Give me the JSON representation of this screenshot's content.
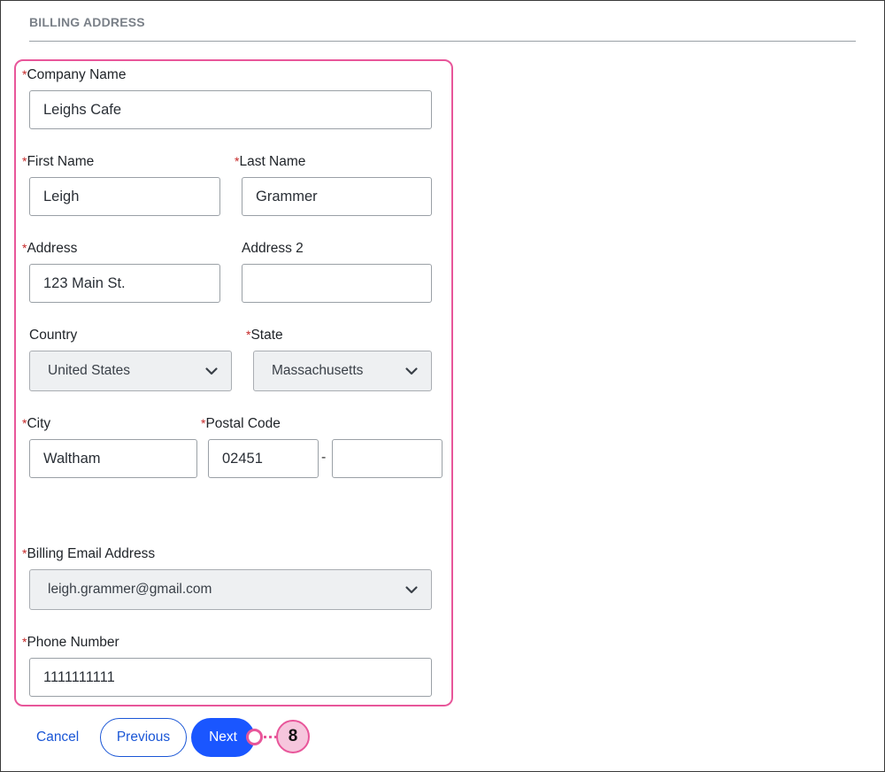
{
  "section": {
    "title": "BILLING ADDRESS"
  },
  "form": {
    "required_mark": "*",
    "company_name": {
      "label": "Company Name",
      "value": "Leighs Cafe"
    },
    "first_name": {
      "label": "First Name",
      "value": "Leigh"
    },
    "last_name": {
      "label": "Last Name",
      "value": "Grammer"
    },
    "address": {
      "label": "Address",
      "value": "123 Main St."
    },
    "address2": {
      "label": "Address 2",
      "value": ""
    },
    "country": {
      "label": "Country",
      "value": "United States"
    },
    "state": {
      "label": "State",
      "value": "Massachusetts"
    },
    "city": {
      "label": "City",
      "value": "Waltham"
    },
    "postal_code": {
      "label": "Postal Code",
      "value": "02451",
      "extension": "",
      "separator": "-"
    },
    "billing_email": {
      "label": "Billing Email Address",
      "value": "leigh.grammer@gmail.com"
    },
    "phone": {
      "label": "Phone Number",
      "value": "1111111111"
    }
  },
  "actions": {
    "cancel": "Cancel",
    "previous": "Previous",
    "next": "Next"
  },
  "callout": {
    "number": "8"
  },
  "colors": {
    "accent": "#1a56ff",
    "highlight": "#e8569a",
    "required": "#c62828"
  },
  "icons": {
    "dropdown": "chevron-down-icon"
  }
}
